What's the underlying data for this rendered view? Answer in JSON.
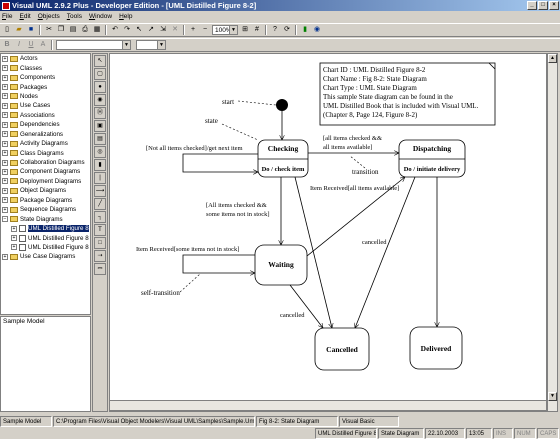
{
  "window": {
    "title": "Visual UML 2.9.2 Plus - Developer Edition - [UML Distilled Figure 8-2]"
  },
  "menu": [
    "File",
    "Edit",
    "Objects",
    "Tools",
    "Window",
    "Help"
  ],
  "toolbar": {
    "zoom": "100%"
  },
  "tree": {
    "items": [
      {
        "label": "Actors",
        "level": 0,
        "type": "folder"
      },
      {
        "label": "Classes",
        "level": 0,
        "type": "folder"
      },
      {
        "label": "Components",
        "level": 0,
        "type": "folder"
      },
      {
        "label": "Packages",
        "level": 0,
        "type": "folder"
      },
      {
        "label": "Nodes",
        "level": 0,
        "type": "folder"
      },
      {
        "label": "Use Cases",
        "level": 0,
        "type": "folder"
      },
      {
        "label": "Associations",
        "level": 0,
        "type": "folder"
      },
      {
        "label": "Dependencies",
        "level": 0,
        "type": "folder"
      },
      {
        "label": "Generalizations",
        "level": 0,
        "type": "folder"
      },
      {
        "label": "Activity Diagrams",
        "level": 0,
        "type": "folder"
      },
      {
        "label": "Class Diagrams",
        "level": 0,
        "type": "folder"
      },
      {
        "label": "Collaboration Diagrams",
        "level": 0,
        "type": "folder"
      },
      {
        "label": "Component Diagrams",
        "level": 0,
        "type": "folder"
      },
      {
        "label": "Deployment Diagrams",
        "level": 0,
        "type": "folder"
      },
      {
        "label": "Object Diagrams",
        "level": 0,
        "type": "folder"
      },
      {
        "label": "Package Diagrams",
        "level": 0,
        "type": "folder"
      },
      {
        "label": "Sequence Diagrams",
        "level": 0,
        "type": "folder"
      },
      {
        "label": "State Diagrams",
        "level": 0,
        "type": "folder",
        "expanded": true
      },
      {
        "label": "UML Distilled Figure 8",
        "level": 1,
        "type": "item",
        "selected": true
      },
      {
        "label": "UML Distilled Figure 8",
        "level": 1,
        "type": "item"
      },
      {
        "label": "UML Distilled Figure 8",
        "level": 1,
        "type": "item"
      },
      {
        "label": "Use Case Diagrams",
        "level": 0,
        "type": "folder"
      }
    ]
  },
  "description_panel": {
    "text": "Sample Model"
  },
  "diagram": {
    "note": [
      "Chart ID : UML Distilled Figure 8-2",
      "Chart Name : Fig 8-2: State Diagram",
      "Chart Type : UML State Diagram",
      "This sample State diagram can be found in the",
      "UML Distilled Book that is included with Visual UML.",
      "(Chapter 8, Page 124, Figure 8-2)"
    ],
    "states": {
      "checking": {
        "name": "Checking",
        "activity": "Do / check item"
      },
      "dispatching": {
        "name": "Dispatching",
        "activity": "Do / initiate delivery"
      },
      "waiting": {
        "name": "Waiting"
      },
      "cancelled": {
        "name": "Cancelled"
      },
      "delivered": {
        "name": "Delivered"
      }
    },
    "labels": {
      "start": "start",
      "state": "state",
      "not_all_checked": "[Not all items checked]/get next item",
      "all_checked_1": "[all items checked &&",
      "all_checked_2": "all items available]",
      "transition": "transition",
      "item_received_all": "Item Received[all items available]",
      "all_checked_stock_1": "[All items checked &&",
      "all_checked_stock_2": "some items not in stock]",
      "item_received_some": "Item Received[some items not in stock]",
      "self_transition": "self-transition",
      "cancelled_1": "cancelled",
      "cancelled_2": "cancelled",
      "cancelled_3": "cancelled"
    }
  },
  "status": {
    "model": "Sample Model",
    "path": "C:\\Program Files\\Visual Object Modelers\\Visual UML\\Samples\\Sample.Uml",
    "diagram": "Fig 8-2: State Diagram",
    "language": "Visual Basic",
    "current": "UML Distilled Figure 8-2",
    "type": "State Diagram",
    "date": "22.10.2003",
    "time": "13:05",
    "ins": "INS",
    "num": "NUM",
    "caps": "CAPS"
  }
}
